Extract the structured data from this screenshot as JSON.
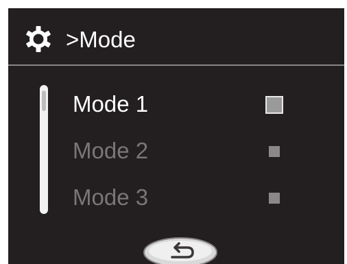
{
  "header": {
    "icon": "gear-icon",
    "breadcrumb": ">Mode"
  },
  "modes": [
    {
      "label": "Mode 1",
      "selected": true
    },
    {
      "label": "Mode 2",
      "selected": false
    },
    {
      "label": "Mode 3",
      "selected": false
    }
  ],
  "footer": {
    "back_icon": "return-arrow-icon"
  },
  "colors": {
    "background": "#231f20",
    "text_active": "#ffffff",
    "text_inactive": "#7a7677"
  }
}
